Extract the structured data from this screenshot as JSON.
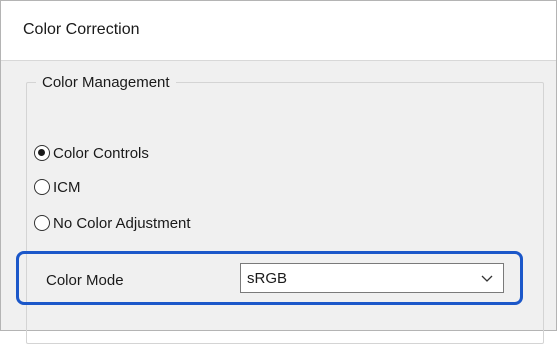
{
  "dialog": {
    "title": "Color Correction"
  },
  "color_management": {
    "legend": "Color Management",
    "options": [
      {
        "label": "Color Controls",
        "checked": true
      },
      {
        "label": "ICM",
        "checked": false
      },
      {
        "label": "No Color Adjustment",
        "checked": false
      }
    ]
  },
  "color_mode": {
    "label": "Color Mode",
    "selected": "sRGB",
    "icon": "chevron-down-icon"
  },
  "colors": {
    "highlight": "#1b57c9",
    "background": "#f0f0f0"
  }
}
